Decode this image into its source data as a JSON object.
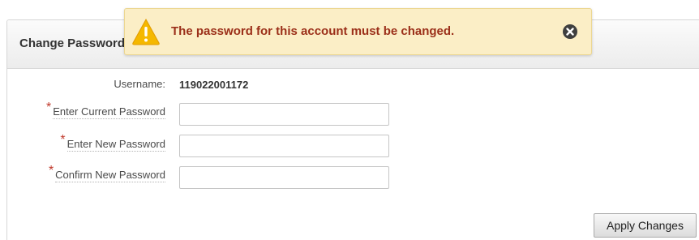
{
  "region": {
    "title": "Change Password"
  },
  "alert": {
    "message": "The password for this account must be changed.",
    "icon": "warning-triangle-icon",
    "close_icon": "close-circle-icon",
    "colors": {
      "background": "#fbeec6",
      "text": "#9b2f19",
      "icon": "#f5b800"
    }
  },
  "form": {
    "required_marker": "*",
    "username": {
      "label": "Username:",
      "value": "119022001172"
    },
    "current_password": {
      "label": "Enter Current Password",
      "value": ""
    },
    "new_password": {
      "label": "Enter New Password",
      "value": ""
    },
    "confirm_password": {
      "label": "Confirm New Password",
      "value": ""
    }
  },
  "actions": {
    "apply_label": "Apply Changes"
  }
}
